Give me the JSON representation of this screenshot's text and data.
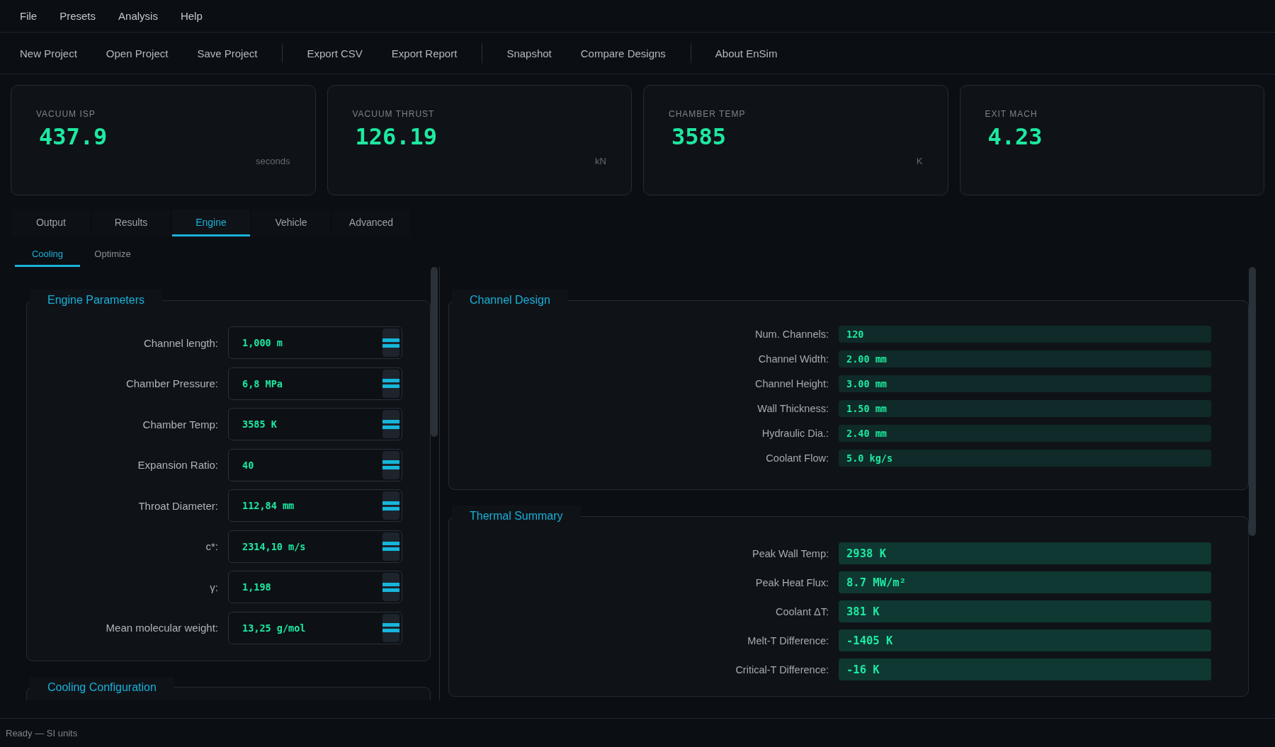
{
  "menu": [
    "File",
    "Presets",
    "Analysis",
    "Help"
  ],
  "toolbar": [
    [
      "New Project",
      "Open Project",
      "Save Project"
    ],
    [
      "Export CSV",
      "Export Report"
    ],
    [
      "Snapshot",
      "Compare Designs"
    ],
    [
      "About EnSim"
    ]
  ],
  "cards": [
    {
      "label": "VACUUM ISP",
      "value": "437.9",
      "unit": "seconds"
    },
    {
      "label": "VACUUM THRUST",
      "value": "126.19",
      "unit": "kN"
    },
    {
      "label": "CHAMBER TEMP",
      "value": "3585",
      "unit": "K"
    },
    {
      "label": "EXIT MACH",
      "value": "4.23"
    }
  ],
  "tabs": [
    {
      "label": "Output",
      "selected": false
    },
    {
      "label": "Results",
      "selected": false
    },
    {
      "label": "Engine",
      "selected": true
    },
    {
      "label": "Vehicle",
      "selected": false
    },
    {
      "label": "Advanced",
      "selected": false
    }
  ],
  "subtabs": [
    {
      "label": "Cooling",
      "selected": true
    },
    {
      "label": "Optimize",
      "selected": false
    }
  ],
  "engine_parameters": {
    "title": "Engine Parameters",
    "fields": [
      {
        "label": "Channel length:",
        "value": "1,000 m"
      },
      {
        "label": "Chamber Pressure:",
        "value": "6,8 MPa"
      },
      {
        "label": "Chamber Temp:",
        "value": "3585 K"
      },
      {
        "label": "Expansion Ratio:",
        "value": "40"
      },
      {
        "label": "Throat Diameter:",
        "value": "112,84 mm"
      },
      {
        "label": "c*:",
        "value": "2314,10 m/s"
      },
      {
        "label": "γ:",
        "value": "1,198"
      },
      {
        "label": "Mean molecular weight:",
        "value": "13,25 g/mol"
      }
    ]
  },
  "cooling_configuration": {
    "title": "Cooling Configuration"
  },
  "channel_design": {
    "title": "Channel Design",
    "rows": [
      {
        "label": "Num. Channels:",
        "value": "120"
      },
      {
        "label": "Channel Width:",
        "value": "2.00 mm"
      },
      {
        "label": "Channel Height:",
        "value": "3.00 mm"
      },
      {
        "label": "Wall Thickness:",
        "value": "1.50 mm"
      },
      {
        "label": "Hydraulic Dia.:",
        "value": "2.40 mm"
      },
      {
        "label": "Coolant Flow:",
        "value": "5.0 kg/s"
      }
    ]
  },
  "thermal_summary": {
    "title": "Thermal Summary",
    "rows": [
      {
        "label": "Peak Wall Temp:",
        "value": "2938 K"
      },
      {
        "label": "Peak Heat Flux:",
        "value": "8.7 MW/m²"
      },
      {
        "label": "Coolant ΔT:",
        "value": "381 K"
      },
      {
        "label": "Melt-T Difference:",
        "value": "-1405 K"
      },
      {
        "label": "Critical-T Difference:",
        "value": "-16 K"
      }
    ]
  },
  "status_bar": "Ready — SI units"
}
